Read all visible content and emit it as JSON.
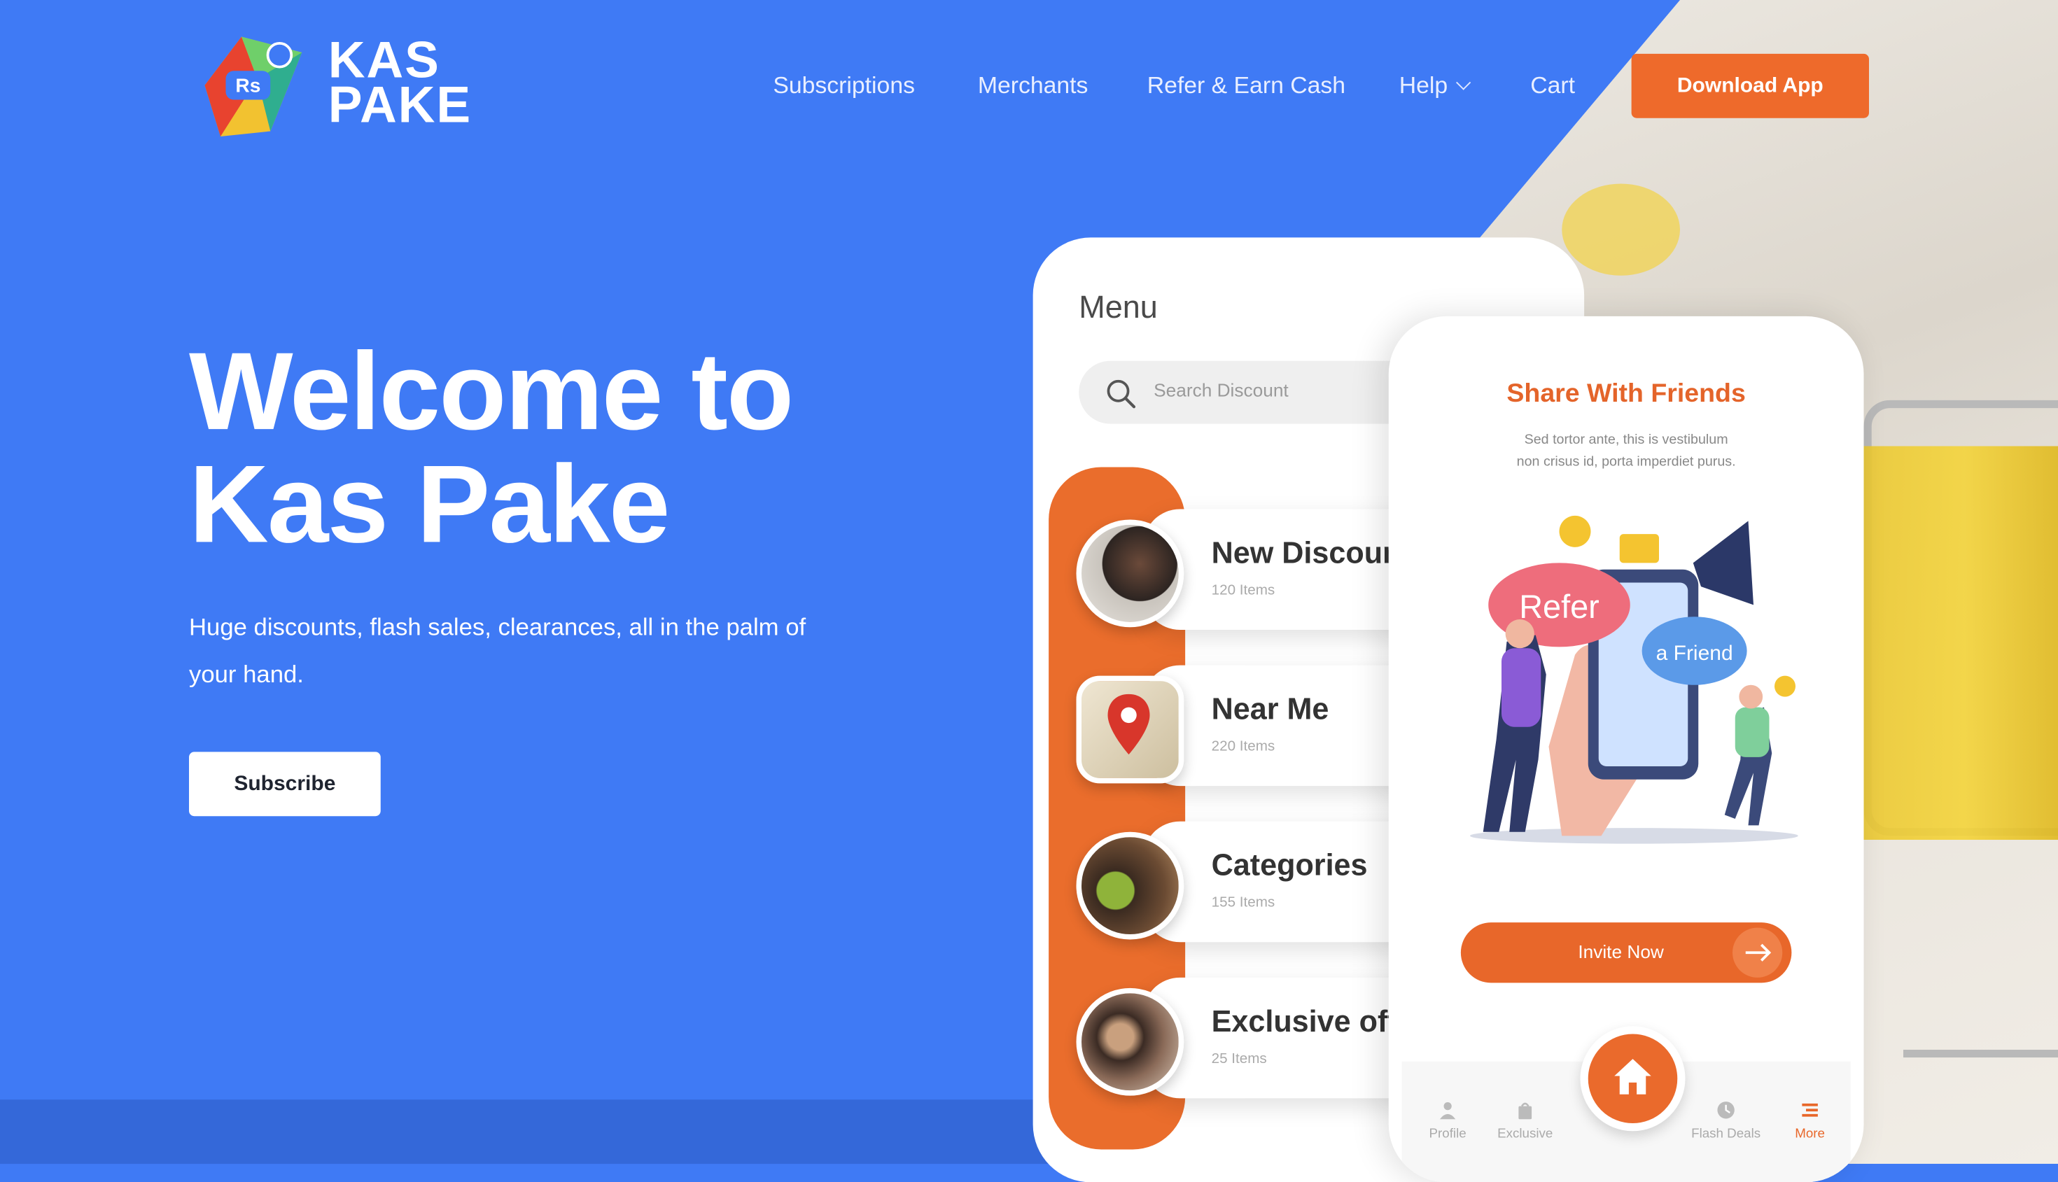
{
  "brand": {
    "name_line1": "KAS",
    "name_line2": "PAKE",
    "logo_badge": "Rs"
  },
  "nav": {
    "items": [
      "Subscriptions",
      "Merchants",
      "Refer & Earn Cash",
      "Help",
      "Cart"
    ],
    "download_label": "Download App"
  },
  "hero": {
    "title_line1": "Welcome to",
    "title_line2": "Kas Pake",
    "subtitle": "Huge discounts, flash sales, clearances, all in the palm of your hand.",
    "subscribe_label": "Subscribe"
  },
  "phone_menu": {
    "title": "Menu",
    "search_placeholder": "Search Discount",
    "items": [
      {
        "title": "New Discounts",
        "count": "120 Items"
      },
      {
        "title": "Near Me",
        "count": "220 Items"
      },
      {
        "title": "Categories",
        "count": "155 Items"
      },
      {
        "title": "Exclusive offers",
        "count": "25 Items"
      }
    ]
  },
  "phone_share": {
    "title": "Share With Friends",
    "description": "Sed tortor ante, this is vestibulum non crisus id, porta imperdiet purus.",
    "bubble_refer": "Refer",
    "bubble_friend": "a Friend",
    "invite_label": "Invite Now",
    "tabs": [
      "Profile",
      "Exclusive",
      "Flash Deals",
      "More"
    ]
  },
  "colors": {
    "primary_blue": "#3f7af5",
    "accent_orange": "#ee6a2b"
  }
}
